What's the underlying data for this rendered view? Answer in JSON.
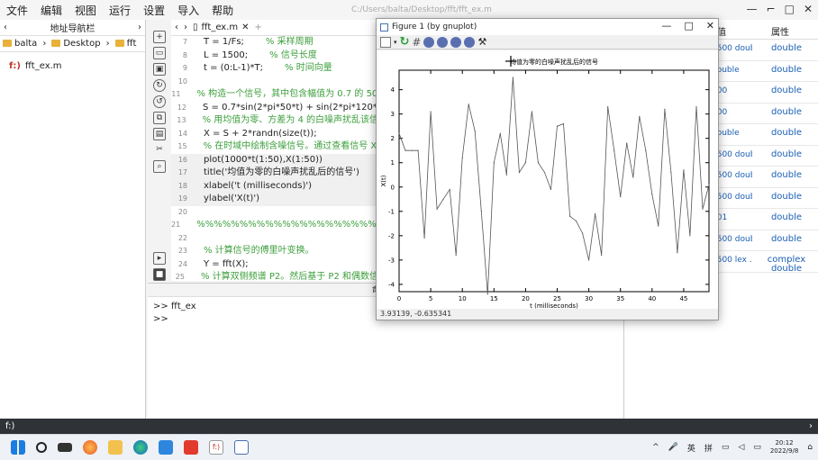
{
  "menubar": {
    "items": [
      "文件",
      "编辑",
      "视图",
      "运行",
      "设置",
      "导入",
      "帮助"
    ],
    "window_path": "C:/Users/balta/Desktop/fft/fft_ex.m",
    "controls": [
      "—",
      "⌐",
      "□",
      "✕"
    ]
  },
  "left_pane": {
    "title": "地址导航栏",
    "breadcrumb": [
      "balta",
      "Desktop",
      "fft"
    ],
    "files": [
      {
        "name": "fft_ex.m",
        "icon": "m-file-icon"
      }
    ]
  },
  "editor": {
    "tab_label": "fft_ex.m",
    "lines": [
      {
        "n": "7",
        "code": "T = 1/Fs;",
        "comment": "% 采样周期"
      },
      {
        "n": "8",
        "code": "L = 1500;",
        "comment": "% 信号长度"
      },
      {
        "n": "9",
        "code": "t = (0:L-1)*T;",
        "comment": "% 时间向量"
      },
      {
        "n": "10",
        "code": "",
        "comment": ""
      },
      {
        "n": "11",
        "code": "",
        "comment": "% 构造一个信号，其中包含幅值为 0.7 的 50 H"
      },
      {
        "n": "12",
        "code": "S = 0.7*sin(2*pi*50*t) + sin(2*pi*120*t);",
        "comment": ""
      },
      {
        "n": "13",
        "code": "",
        "comment": "% 用均值为零、方差为 4 的白噪声扰乱该信号"
      },
      {
        "n": "14",
        "code": "X = S + 2*randn(size(t));",
        "comment": ""
      },
      {
        "n": "15",
        "code": "",
        "comment": "% 在时域中绘制含噪信号。通过查看信号 X(t)"
      },
      {
        "n": "16",
        "code": "plot(1000*t(1:50),X(1:50))",
        "comment": ""
      },
      {
        "n": "17",
        "code": "title('均值为零的白噪声扰乱后的信号')",
        "comment": ""
      },
      {
        "n": "18",
        "code": "xlabel('t (milliseconds)')",
        "comment": ""
      },
      {
        "n": "19",
        "code": "ylabel('X(t)')",
        "comment": ""
      },
      {
        "n": "20",
        "code": "",
        "comment": ""
      },
      {
        "n": "21",
        "code": "",
        "comment": "%%%%%%%%%%%%%%%%%%%%%%%%"
      },
      {
        "n": "22",
        "code": "",
        "comment": ""
      },
      {
        "n": "23",
        "code": "",
        "comment": "% 计算信号的傅里叶变换。"
      },
      {
        "n": "24",
        "code": "Y = fft(X);",
        "comment": ""
      },
      {
        "n": "25",
        "code": "",
        "comment": "% 计算双侧频谱 P2。然后基于 P2 和偶数信号"
      }
    ]
  },
  "console": {
    "title": "命令行",
    "lines": [
      ">> fft_ex",
      ">>"
    ]
  },
  "workspace": {
    "col_value": "值",
    "col_type": "属性",
    "rows": [
      {
        "value": "1500 double",
        "type": "double"
      },
      {
        "value": "double",
        "type": "double"
      },
      {
        "value": "000",
        "type": "double"
      },
      {
        "value": "500",
        "type": "double"
      },
      {
        "value": "double",
        "type": "double"
      },
      {
        "value": "1500 double",
        "type": "double"
      },
      {
        "value": "1500 double",
        "type": "double"
      },
      {
        "value": "1500 double",
        "type": "double"
      },
      {
        "value": "001",
        "type": "double"
      },
      {
        "value": "1500 double",
        "type": "double"
      },
      {
        "value": "1500 lex ...",
        "type": "complex double"
      }
    ]
  },
  "statusbar": {
    "left": "f:)",
    "right": "›"
  },
  "taskbar": {
    "icons": [
      "windows-start-icon",
      "search-icon",
      "task-view-icon",
      "firefox-icon",
      "file-explorer-icon",
      "edge-icon",
      "photos-icon",
      "wps-icon",
      "octave-icon",
      "gnuplot-icon"
    ],
    "tray": [
      "^",
      "🎤",
      "英",
      "拼"
    ],
    "time": "20:12",
    "date": "2022/9/8"
  },
  "figure": {
    "window_title": "Figure 1 (by gnuplot)",
    "status": "3.93139, -0.635341",
    "colors": {
      "line": "#555555",
      "frame": "#000000"
    }
  },
  "chart_data": {
    "type": "line",
    "title": "均值为零的白噪声扰乱后的信号",
    "xlabel": "t (milliseconds)",
    "ylabel": "X(t)",
    "xlim": [
      0,
      49
    ],
    "ylim": [
      -4.3,
      4.8
    ],
    "xticks": [
      0,
      5,
      10,
      15,
      20,
      25,
      30,
      35,
      40,
      45
    ],
    "yticks": [
      -4,
      -3,
      -2,
      -1,
      0,
      1,
      2,
      3,
      4
    ],
    "x": [
      0,
      1,
      2,
      3,
      4,
      5,
      6,
      7,
      8,
      9,
      10,
      11,
      12,
      13,
      14,
      15,
      16,
      17,
      18,
      19,
      20,
      21,
      22,
      23,
      24,
      25,
      26,
      27,
      28,
      29,
      30,
      31,
      32,
      33,
      34,
      35,
      36,
      37,
      38,
      39,
      40,
      41,
      42,
      43,
      44,
      45,
      46,
      47,
      48,
      49
    ],
    "series": [
      {
        "values": [
          2.2,
          1.5,
          1.5,
          1.5,
          -2.1,
          3.1,
          -0.9,
          -0.5,
          -0.1,
          -2.8,
          1.2,
          3.4,
          2.3,
          -1.0,
          -4.4,
          1.0,
          2.2,
          0.5,
          4.5,
          0.6,
          1.0,
          3.1,
          1.0,
          0.6,
          -0.1,
          2.5,
          2.6,
          -1.2,
          -1.4,
          -1.9,
          -3.0,
          -1.1,
          -2.8,
          3.3,
          1.5,
          -0.4,
          1.8,
          0.4,
          2.9,
          1.5,
          -0.3,
          -1.6,
          3.2,
          0.6,
          -2.7,
          0.7,
          -2.0,
          3.3,
          -0.9,
          0.1,
          -0.1
        ]
      }
    ]
  }
}
